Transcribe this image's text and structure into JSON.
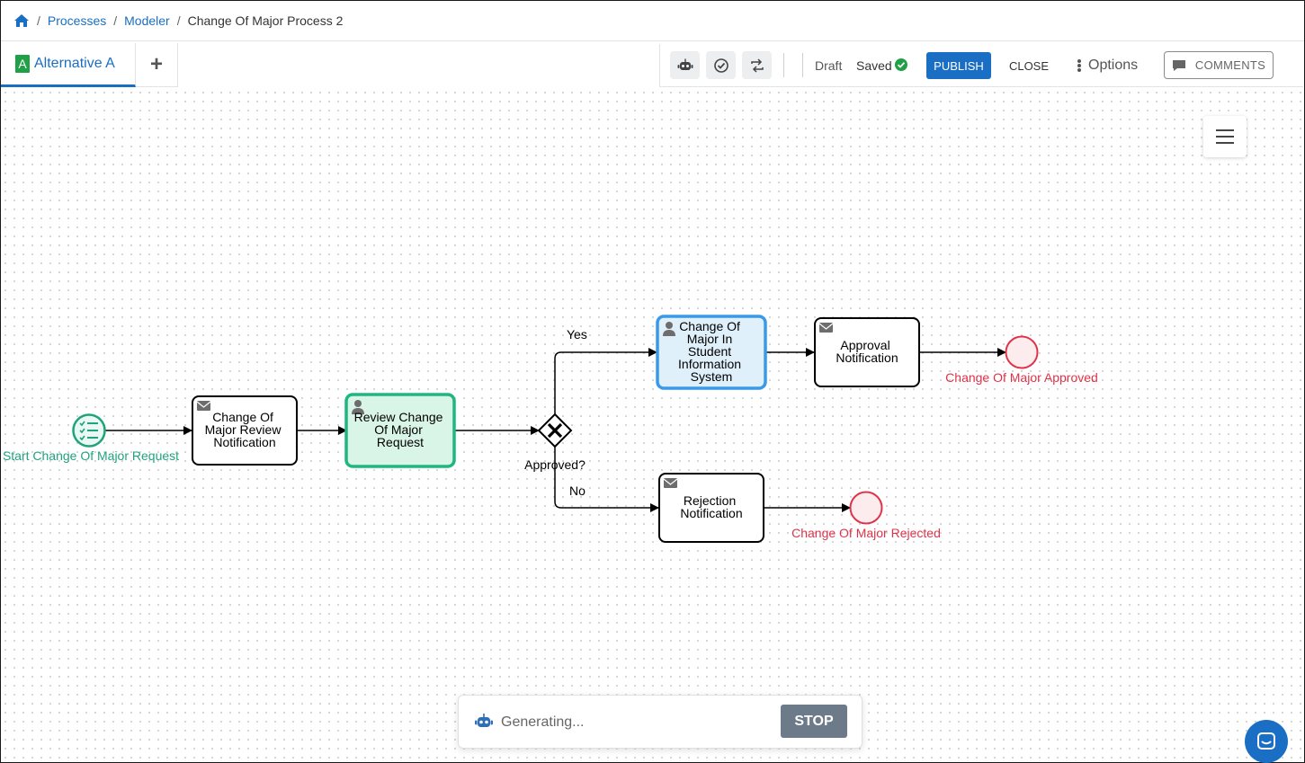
{
  "breadcrumb": {
    "home_icon": "home-icon",
    "items": [
      "Processes",
      "Modeler"
    ],
    "current": "Change Of Major Process 2"
  },
  "tabs": {
    "active": {
      "letter": "A",
      "label": "Alternative A"
    },
    "add_label": "+"
  },
  "toolbar": {
    "status_draft": "Draft",
    "status_saved": "Saved",
    "publish_label": "PUBLISH",
    "close_label": "CLOSE",
    "options_label": "Options",
    "comments_label": "COMMENTS"
  },
  "diagram": {
    "start_event": "Start Change Of Major Request",
    "task_review_notification": [
      "Change Of",
      "Major Review",
      "Notification"
    ],
    "task_review_request": [
      "Review Change",
      "Of Major",
      "Request"
    ],
    "gateway": "Approved?",
    "flow_yes": "Yes",
    "flow_no": "No",
    "task_sis": [
      "Change Of",
      "Major In",
      "Student",
      "Information",
      "System"
    ],
    "task_approval_notification": [
      "Approval",
      "Notification"
    ],
    "task_rejection_notification": [
      "Rejection",
      "Notification"
    ],
    "end_approved": "Change Of Major Approved",
    "end_rejected": "Change Of Major Rejected"
  },
  "generator": {
    "status": "Generating...",
    "stop_label": "STOP"
  },
  "colors": {
    "accent": "#1a6fc4",
    "start_event": "#1fa37b",
    "end_event": "#e0334a",
    "review_task_fill": "#d9f5e7",
    "selected_task_fill": "#dff0fb"
  }
}
